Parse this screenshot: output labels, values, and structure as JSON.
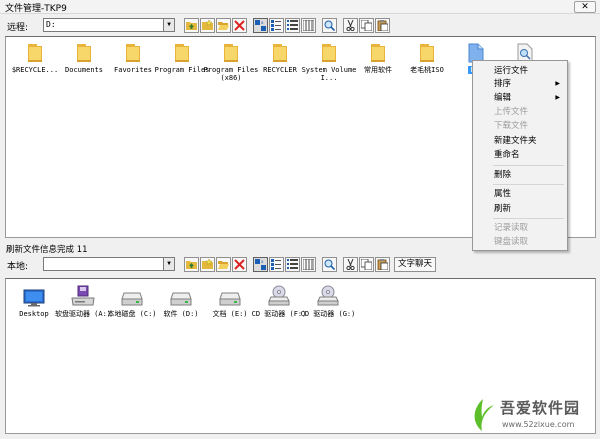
{
  "window": {
    "title": "文件管理-TKP9",
    "close_glyph": "✕"
  },
  "remote": {
    "label": "远程:",
    "path": "D:",
    "items": [
      {
        "label": "$RECYCLE...",
        "icon": "folder-icon"
      },
      {
        "label": "Documents",
        "icon": "folder-icon"
      },
      {
        "label": "Favorites",
        "icon": "folder-icon"
      },
      {
        "label": "Program Files",
        "icon": "folder-icon"
      },
      {
        "label": "Program Files (x86)",
        "icon": "folder-icon"
      },
      {
        "label": "RECYCLER",
        "icon": "folder-icon"
      },
      {
        "label": "System Volume I...",
        "icon": "folder-icon"
      },
      {
        "label": "常用软件",
        "icon": "folder-icon"
      },
      {
        "label": "老毛桃ISO",
        "icon": "folder-icon"
      },
      {
        "label": "P盘",
        "icon": "file-icon",
        "selected": true
      },
      {
        "label": "",
        "icon": "file-search-icon"
      }
    ]
  },
  "context_menu": {
    "items": [
      {
        "label": "运行文件",
        "enabled": true
      },
      {
        "label": "排序",
        "enabled": true,
        "submenu": true
      },
      {
        "label": "编辑",
        "enabled": true,
        "submenu": true
      },
      {
        "label": "上传文件",
        "enabled": false
      },
      {
        "label": "下载文件",
        "enabled": false
      },
      {
        "label": "新建文件夹",
        "enabled": true
      },
      {
        "label": "重命名",
        "enabled": true
      },
      {
        "label": "删除",
        "enabled": true
      },
      {
        "label": "属性",
        "enabled": true
      },
      {
        "label": "刷新",
        "enabled": true
      },
      {
        "label": "记录读取",
        "enabled": false
      },
      {
        "label": "键盘读取",
        "enabled": false
      }
    ],
    "submenu_glyph": "▶"
  },
  "status": {
    "text": "刷新文件信息完成 11"
  },
  "local": {
    "label": "本地:",
    "path": "",
    "text_button": "文字聊天",
    "items": [
      {
        "label": "Desktop",
        "icon": "desktop-icon"
      },
      {
        "label": "软盘驱动器 (A:)",
        "icon": "floppy-drive-icon"
      },
      {
        "label": "本地磁盘 (C:)",
        "icon": "hard-drive-icon"
      },
      {
        "label": "软件 (D:)",
        "icon": "hard-drive-icon"
      },
      {
        "label": "文档 (E:)",
        "icon": "hard-drive-icon"
      },
      {
        "label": "CD 驱动器 (F:)",
        "icon": "cd-drive-icon"
      },
      {
        "label": "CD 驱动器 (G:)",
        "icon": "cd-drive-icon"
      }
    ]
  },
  "combo_arrow": "▼",
  "toolbar_icons": [
    "up-folder-icon",
    "new-folder-icon",
    "open-folder-icon",
    "delete-icon",
    "large-icons-view-icon",
    "small-icons-view-icon",
    "list-view-icon",
    "details-view-icon",
    "search-icon",
    "cut-icon",
    "copy-icon",
    "paste-icon"
  ],
  "watermark": {
    "brand": "吾爱软件园",
    "url": "www.52zixue.com"
  },
  "colors": {
    "selection": "#3399ff",
    "folder": "#f5c842",
    "disabled": "#9c9c9c"
  }
}
